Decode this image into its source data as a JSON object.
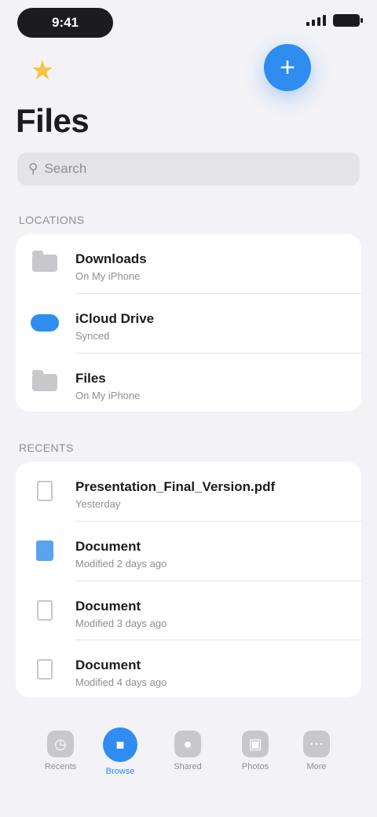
{
  "status": {
    "time": "9:41"
  },
  "header": {
    "title": "Files",
    "search_placeholder": "Search"
  },
  "locations": {
    "section_label": "Locations",
    "items": [
      {
        "title": "Downloads",
        "subtitle": "On My iPhone"
      },
      {
        "title": "iCloud Drive",
        "subtitle": "Synced"
      },
      {
        "title": "Files",
        "subtitle": "On My iPhone"
      }
    ]
  },
  "recents": {
    "section_label": "Recents",
    "items": [
      {
        "title": "Presentation_Final_Version.pdf",
        "subtitle": "Yesterday"
      },
      {
        "title": "Document",
        "subtitle": "Modified 2 days ago"
      },
      {
        "title": "Document",
        "subtitle": "Modified 3 days ago"
      },
      {
        "title": "Document",
        "subtitle": "Modified 4 days ago"
      }
    ]
  },
  "tabs": [
    {
      "label": "Recents",
      "icon": "clock-icon"
    },
    {
      "label": "Browse",
      "icon": "folder-icon",
      "active": true
    },
    {
      "label": "Shared",
      "icon": "person-icon"
    },
    {
      "label": "Photos",
      "icon": "photo-icon"
    },
    {
      "label": "More",
      "icon": "ellipsis-icon"
    }
  ],
  "colors": {
    "accent": "#2f8cf0",
    "star": "#f5c542",
    "background": "#f2f2f7"
  }
}
